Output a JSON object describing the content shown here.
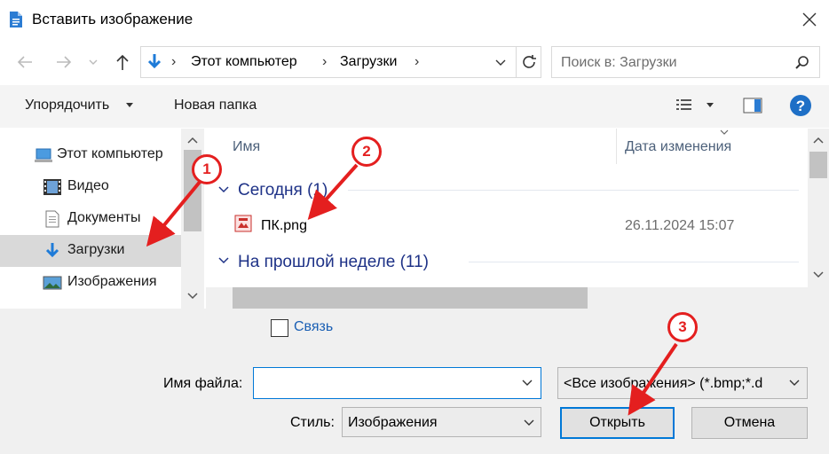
{
  "window": {
    "title": "Вставить изображение"
  },
  "address": {
    "crumbs": [
      "Этот компьютер",
      "Загрузки"
    ]
  },
  "search": {
    "placeholder": "Поиск в: Загрузки"
  },
  "toolbar": {
    "organize_label": "Упорядочить",
    "new_folder_label": "Новая папка"
  },
  "nav": {
    "items": [
      {
        "label": "Этот компьютер",
        "icon": "computer-icon"
      },
      {
        "label": "Видео",
        "icon": "video-icon"
      },
      {
        "label": "Документы",
        "icon": "document-icon"
      },
      {
        "label": "Загрузки",
        "icon": "download-icon",
        "selected": true
      },
      {
        "label": "Изображения",
        "icon": "images-icon"
      }
    ]
  },
  "files": {
    "columns": {
      "name": "Имя",
      "date": "Дата изменения"
    },
    "groups": [
      {
        "label": "Сегодня (1)",
        "items": [
          {
            "name": "ПК.png",
            "date": "26.11.2024 15:07",
            "icon": "png-file-icon"
          }
        ]
      },
      {
        "label": "На прошлой неделе (11)",
        "items": []
      }
    ]
  },
  "options": {
    "link_label": "Связь"
  },
  "filename": {
    "label": "Имя файла:",
    "value": ""
  },
  "filter": {
    "value": "<Все изображения> (*.bmp;*.d"
  },
  "style": {
    "label": "Стиль:",
    "value": "Изображения"
  },
  "buttons": {
    "open_label": "Открыть",
    "cancel_label": "Отмена"
  },
  "annotations": {
    "badges": [
      "1",
      "2",
      "3"
    ],
    "color": "#e41f1f"
  },
  "colors": {
    "accent": "#0078d7",
    "group_header": "#1e3287",
    "selected_bg": "#d9d9d9"
  }
}
